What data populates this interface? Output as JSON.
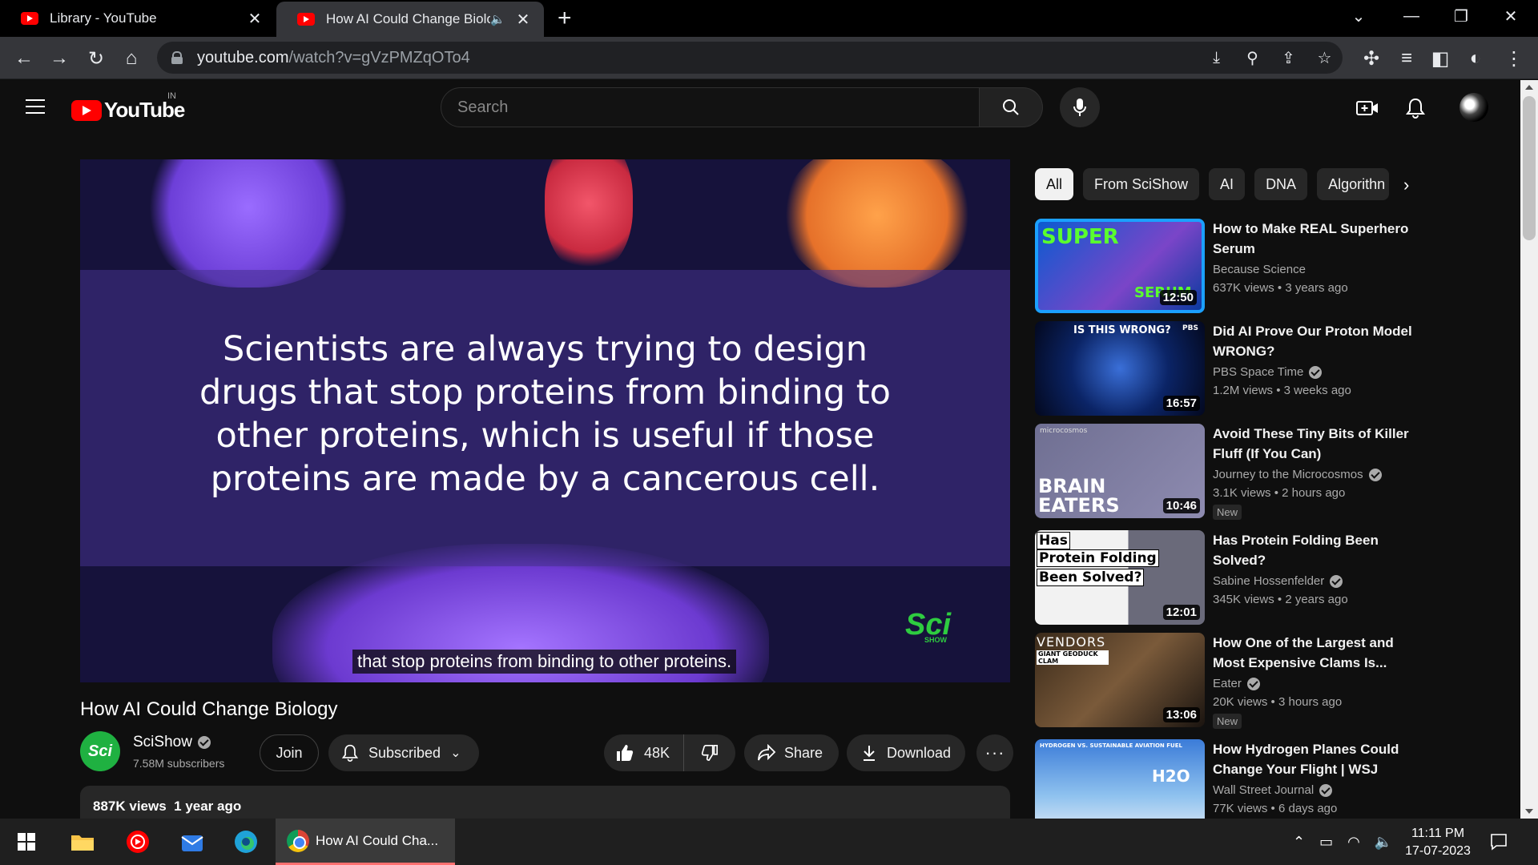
{
  "browser": {
    "tabs": [
      {
        "title": "Library - YouTube"
      },
      {
        "title": "How AI Could Change Biology"
      }
    ],
    "url_host": "youtube.com",
    "url_path": "/watch?v=gVzPMZqOTo4"
  },
  "header": {
    "logo_text": "YouTube",
    "country_code": "IN",
    "search_placeholder": "Search"
  },
  "player": {
    "overlay_text": "Scientists are always trying to design drugs that stop proteins from binding to other proteins, which is useful if those proteins are made by a cancerous cell.",
    "subtitle": "that stop proteins from binding to other proteins.",
    "watermark": "Sci",
    "watermark_sub": "SHOW"
  },
  "video": {
    "title": "How AI Could Change Biology",
    "channel": "SciShow",
    "channel_avatar_text": "Sci",
    "subscribers": "7.58M subscribers",
    "join_label": "Join",
    "subscribed_label": "Subscribed",
    "likes": "48K",
    "share_label": "Share",
    "download_label": "Download",
    "views": "887K views",
    "age": "1 year ago"
  },
  "chips": [
    "All",
    "From SciShow",
    "AI",
    "DNA",
    "Algorithn"
  ],
  "recommendations": [
    {
      "title": "How to Make REAL Superhero Serum",
      "channel": "Because Science",
      "verified": false,
      "views": "637K views",
      "age": "3 years ago",
      "duration": "12:50",
      "is_new": false,
      "thumb_text": "SUPER",
      "thumb_text2": "SERUM"
    },
    {
      "title": "Did AI Prove Our Proton Model WRONG?",
      "channel": "PBS Space Time",
      "verified": true,
      "views": "1.2M views",
      "age": "3 weeks ago",
      "duration": "16:57",
      "is_new": false,
      "thumb_text": "IS THIS WRONG?",
      "thumb_text2": "PBS"
    },
    {
      "title": "Avoid These Tiny Bits of Killer Fluff (If You Can)",
      "channel": "Journey to the Microcosmos",
      "verified": true,
      "views": "3.1K views",
      "age": "2 hours ago",
      "duration": "10:46",
      "is_new": true,
      "thumb_text": "BRAIN EATERS",
      "thumb_text2": "microcosmos"
    },
    {
      "title": "Has Protein Folding Been Solved?",
      "channel": "Sabine Hossenfelder",
      "verified": true,
      "views": "345K views",
      "age": "2 years ago",
      "duration": "12:01",
      "is_new": false,
      "thumb_text": "Has",
      "thumb_text2": "Protein Folding",
      "thumb_text3": "Been Solved?"
    },
    {
      "title": "How One of the Largest and Most Expensive Clams Is...",
      "channel": "Eater",
      "verified": true,
      "views": "20K views",
      "age": "3 hours ago",
      "duration": "13:06",
      "is_new": true,
      "thumb_text": "VENDORS",
      "thumb_text2": "GIANT GEODUCK CLAM"
    },
    {
      "title": "How Hydrogen Planes Could Change Your Flight | WSJ",
      "channel": "Wall Street Journal",
      "verified": true,
      "views": "77K views",
      "age": "6 days ago",
      "duration": "",
      "is_new": false,
      "thumb_text": "HYDROGEN VS. SUSTAINABLE AVIATION FUEL",
      "thumb_text2": "H2O"
    }
  ],
  "new_badge": "New",
  "taskbar": {
    "active_task": "How AI Could Cha...",
    "time": "11:11 PM",
    "date": "17-07-2023"
  },
  "colors": {
    "yt_red": "#ff0000",
    "background": "#0f0f0f",
    "scishow_green": "#1fb141"
  }
}
